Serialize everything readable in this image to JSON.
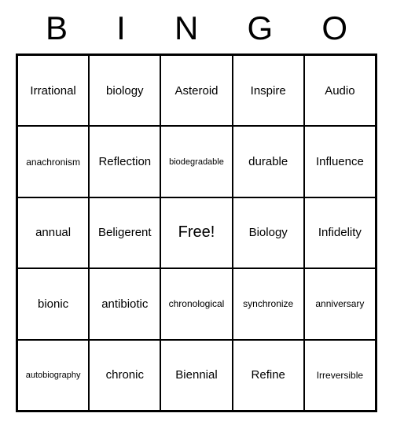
{
  "header": [
    "B",
    "I",
    "N",
    "G",
    "O"
  ],
  "grid": [
    [
      "Irrational",
      "biology",
      "Asteroid",
      "Inspire",
      "Audio"
    ],
    [
      "anachronism",
      "Reflection",
      "biodegradable",
      "durable",
      "Influence"
    ],
    [
      "annual",
      "Beligerent",
      "Free!",
      "Biology",
      "Infidelity"
    ],
    [
      "bionic",
      "antibiotic",
      "chronological",
      "synchronize",
      "anniversary"
    ],
    [
      "autobiography",
      "chronic",
      "Biennial",
      "Refine",
      "Irreversible"
    ]
  ]
}
